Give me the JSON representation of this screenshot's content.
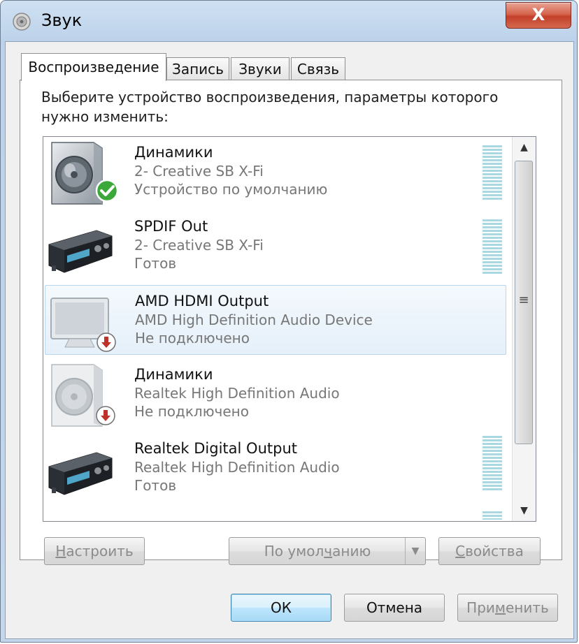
{
  "window": {
    "title": "Звук",
    "close_label": "X"
  },
  "tabs": [
    {
      "label": "Воспроизведение",
      "active": true
    },
    {
      "label": "Запись",
      "active": false
    },
    {
      "label": "Звуки",
      "active": false
    },
    {
      "label": "Связь",
      "active": false
    }
  ],
  "instructions": "Выберите устройство воспроизведения, параметры которого нужно изменить:",
  "devices": [
    {
      "name": "Динамики",
      "driver": "2- Creative SB X-Fi",
      "status": "Устройство по умолчанию",
      "icon": "speaker-icon",
      "badge": "default-check-icon"
    },
    {
      "name": "SPDIF Out",
      "driver": "2- Creative SB X-Fi",
      "status": "Готов",
      "icon": "digital-output-icon",
      "badge": ""
    },
    {
      "name": "AMD HDMI Output",
      "driver": "AMD High Definition Audio Device",
      "status": "Не подключено",
      "icon": "monitor-icon",
      "badge": "disconnected-icon"
    },
    {
      "name": "Динамики",
      "driver": "Realtek High Definition Audio",
      "status": "Не подключено",
      "icon": "speaker-icon",
      "badge": "disconnected-icon"
    },
    {
      "name": "Realtek Digital Output",
      "driver": "Realtek High Definition Audio",
      "status": "Готов",
      "icon": "digital-output-icon",
      "badge": ""
    }
  ],
  "buttons": {
    "configure": {
      "pre": "",
      "accel": "Н",
      "post": "астроить"
    },
    "set_default": {
      "pre": "По умол",
      "accel": "ч",
      "post": "анию"
    },
    "properties": {
      "pre": "",
      "accel": "С",
      "post": "войства"
    },
    "ok": "ОК",
    "cancel": "Отмена",
    "apply": {
      "pre": "При",
      "accel": "м",
      "post": "енить"
    }
  },
  "colors": {
    "title_bar": "#c3d6ec",
    "close_button": "#c4402a",
    "selection": "#e5f0fa",
    "meter": "#a8d8e2",
    "check": "#3da83a",
    "disconnected": "#c0302a"
  }
}
